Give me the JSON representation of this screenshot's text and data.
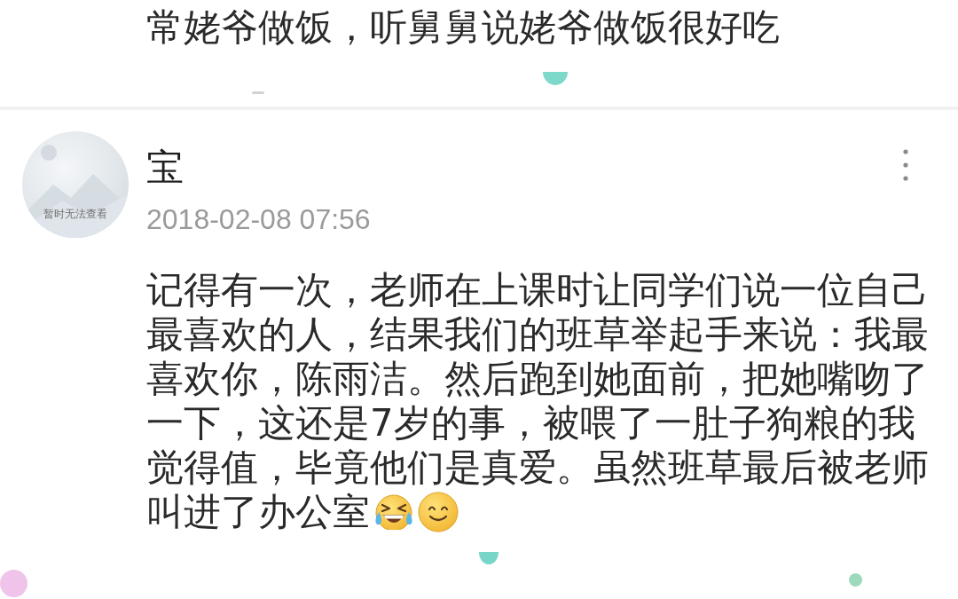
{
  "previous_comment": {
    "text": "常姥爷做饭，听舅舅说姥爷做饭很好吃"
  },
  "comment": {
    "avatar": {
      "caption": "暂时无法查看"
    },
    "author": "宝",
    "timestamp": "2018-02-08 07:56",
    "text": "记得有一次，老师在上课时让同学们说一位自己最喜欢的人，结果我们的班草举起手来说：我最喜欢你，陈雨洁。然后跑到她面前，把她嘴吻了一下，这还是7岁的事，被喂了一肚子狗粮的我觉得值，毕竟他们是真爱。虽然班草最后被老师",
    "text_last_line": "叫进了办公室",
    "emojis": [
      {
        "kind": "laughing-tears"
      },
      {
        "kind": "smile"
      }
    ]
  },
  "decorations": [
    {
      "kind": "half-disc",
      "color": "#7fd9cb"
    },
    {
      "kind": "dash",
      "color": "#d2d2d2"
    },
    {
      "kind": "half-disc",
      "color": "#77d6c8"
    },
    {
      "kind": "disc",
      "color": "#9dd9bb"
    },
    {
      "kind": "disc",
      "color": "#f0c4ea"
    }
  ]
}
